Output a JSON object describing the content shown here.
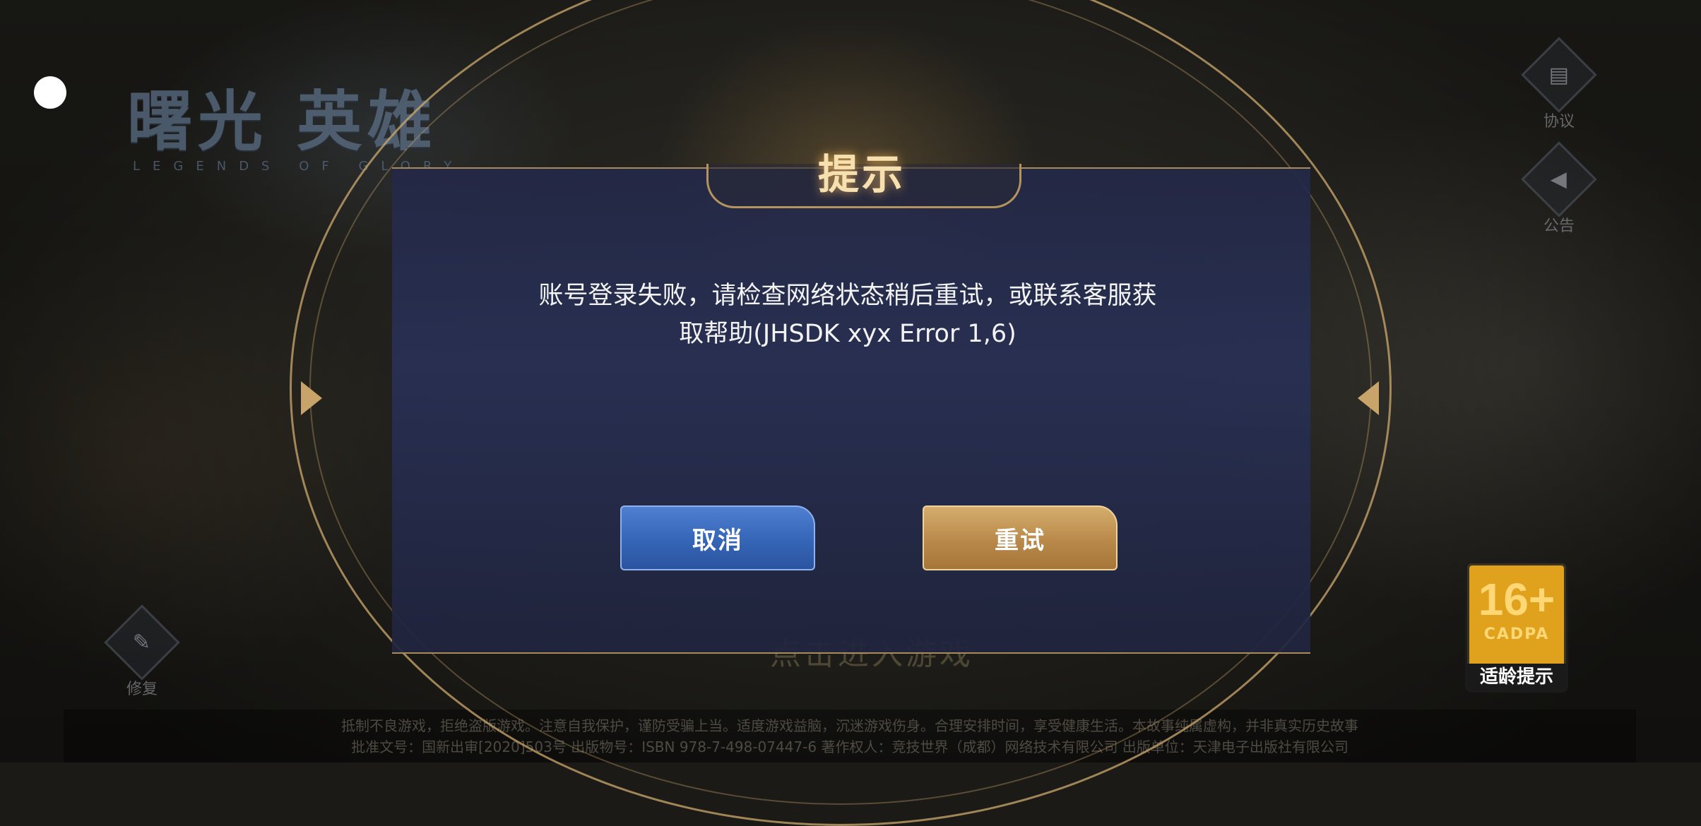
{
  "game": {
    "logo_title": "曙光 英雄",
    "logo_subtitle": "LEGENDS OF GLORY"
  },
  "side_buttons": {
    "agreement": {
      "label": "协议",
      "icon": "document-check-icon"
    },
    "announcement": {
      "label": "公告",
      "icon": "megaphone-icon"
    },
    "repair": {
      "label": "修复",
      "icon": "wrench-icon"
    }
  },
  "age_rating": {
    "age": "16+",
    "org": "CADPA",
    "tip": "适龄提示"
  },
  "background_enter_text": "点击进入游戏",
  "footer": {
    "line1": "抵制不良游戏，拒绝盗版游戏。注意自我保护，谨防受骗上当。适度游戏益脑，沉迷游戏伤身。合理安排时间，享受健康生活。本故事纯属虚构，并非真实历史故事",
    "line2": "批准文号：国新出审[2020]503号  出版物号：ISBN 978-7-498-07447-6  著作权人：竞技世界（成都）网络技术有限公司  出版单位：天津电子出版社有限公司"
  },
  "dialog": {
    "title": "提示",
    "message_line1": "账号登录失败，请检查网络状态稍后重试，或联系客服获",
    "message_line2": "取帮助(JHSDK xyx Error 1,6)",
    "cancel_label": "取消",
    "retry_label": "重试"
  },
  "colors": {
    "accent_gold": "#c9a46a",
    "cancel_blue": "#3565b6",
    "retry_gold": "#b9894a",
    "dialog_bg": "#28305a"
  }
}
